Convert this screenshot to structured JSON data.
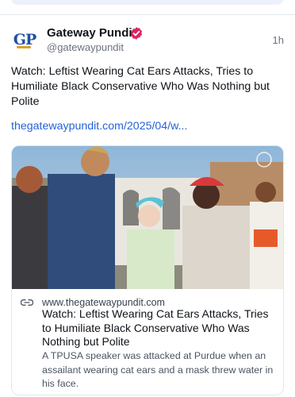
{
  "post": {
    "author_name": "Gateway Pundit",
    "author_handle": "@gatewaypundit",
    "avatar_initials": "GP",
    "time": "1h",
    "text": "Watch: Leftist Wearing Cat Ears Attacks, Tries to Humiliate Black Conservative Who Was Nothing but Polite",
    "link_text": "thegatewaypundit.com/2025/04/w...",
    "icons": {
      "verified": "verified-badge-icon",
      "link": "link-chain-icon"
    },
    "colors": {
      "link": "#2563d6",
      "verified": "#e0245e",
      "brand": "#1f4fa3"
    }
  },
  "card": {
    "domain": "www.thegatewaypundit.com",
    "title": "Watch: Leftist Wearing Cat Ears Attacks, Tries to Humiliate Black Conservative Who Was Nothing but Polite",
    "description": "A TPUSA speaker was attacked at Purdue when an assailant wearing cat ears and a mask threw water in his face."
  }
}
